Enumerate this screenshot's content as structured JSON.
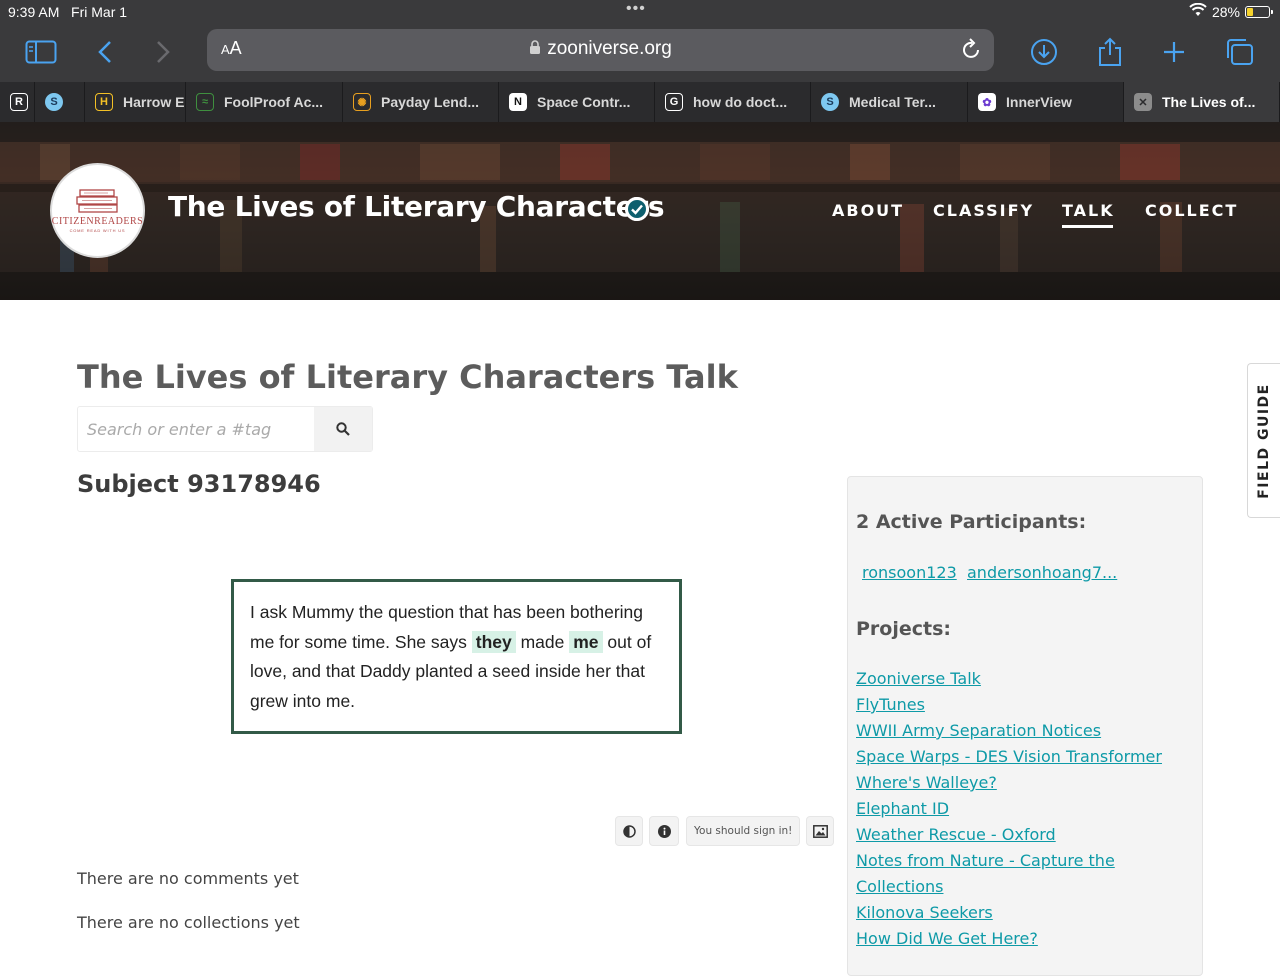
{
  "status_bar": {
    "time": "9:39 AM",
    "date": "Fri Mar 1",
    "battery": "28%",
    "battery_level": 0.28
  },
  "browser": {
    "aa_label_small": "A",
    "aa_label_large": "A",
    "url": "zooniverse.org",
    "tabs": [
      {
        "favicon": "R",
        "label": "",
        "favicon_bg": "#2b2b2d",
        "favicon_fg": "#ffffff"
      },
      {
        "favicon": "S",
        "label": "",
        "favicon_bg": "#7ec8f0",
        "favicon_fg": "#1b3a5a"
      },
      {
        "favicon": "H",
        "label": "Harrow E",
        "favicon_bg": "#2b2b2d",
        "favicon_fg": "#f3c026"
      },
      {
        "favicon": "≈",
        "label": "FoolProof Ac...",
        "favicon_bg": "#2b2b2d",
        "favicon_fg": "#3f8f3f"
      },
      {
        "favicon": "✺",
        "label": "Payday Lend...",
        "favicon_bg": "#2b2b2d",
        "favicon_fg": "#e8a020"
      },
      {
        "favicon": "N",
        "label": "Space Contr...",
        "favicon_bg": "#ffffff",
        "favicon_fg": "#111111"
      },
      {
        "favicon": "G",
        "label": "how do doct...",
        "favicon_bg": "#2b2b2d",
        "favicon_fg": "#ffffff"
      },
      {
        "favicon": "S",
        "label": "Medical Ter...",
        "favicon_bg": "#7ec8f0",
        "favicon_fg": "#1b3a5a"
      },
      {
        "favicon": "✿",
        "label": "InnerView",
        "favicon_bg": "#ffffff",
        "favicon_fg": "#6c3bd0"
      },
      {
        "favicon": "✕",
        "label": "The Lives of...",
        "favicon_bg": "#8c8c8c",
        "favicon_fg": "#2b2b2d",
        "active": true
      }
    ]
  },
  "header": {
    "logo": {
      "brand": "CITIZENREADERS",
      "tagline": "COME READ WITH US"
    },
    "title": "The Lives of Literary Characters",
    "nav": [
      "ABOUT",
      "CLASSIFY",
      "TALK",
      "COLLECT"
    ],
    "active_nav": "TALK"
  },
  "main": {
    "talk_title": "The Lives of Literary Characters Talk",
    "search_placeholder": "Search or enter a #tag",
    "subject_title": "Subject 93178946",
    "subject_text": {
      "part1": "I ask Mummy the question that has been bothering me for some time. She says ",
      "highlight1": "they",
      "part2": " made ",
      "highlight2": "me",
      "part3": " out of love, and that Daddy planted a seed inside her that grew into me."
    },
    "sign_in_text": "You should sign in!",
    "no_comments": "There are no comments yet",
    "no_collections": "There are no collections yet"
  },
  "sidebar": {
    "participants_heading": "2 Active Participants:",
    "participants": [
      "ronsoon123",
      "andersonhoang7..."
    ],
    "projects_heading": "Projects:",
    "projects": [
      "Zooniverse Talk",
      "FlyTunes",
      "WWII Army Separation Notices",
      "Space Warps - DES Vision Transformer",
      "Where's Walleye?",
      "Elephant ID",
      "Weather Rescue - Oxford",
      "Notes from Nature - Capture the ",
      "Collections",
      "Kilonova Seekers",
      "How Did We Get Here?"
    ]
  },
  "field_guide_label": "FIELD GUIDE",
  "colors": {
    "accent_link": "#0e9aa7",
    "card_border": "#325a47",
    "highlight": "#d7f1e6",
    "browser_chrome": "#3a3a3c"
  }
}
